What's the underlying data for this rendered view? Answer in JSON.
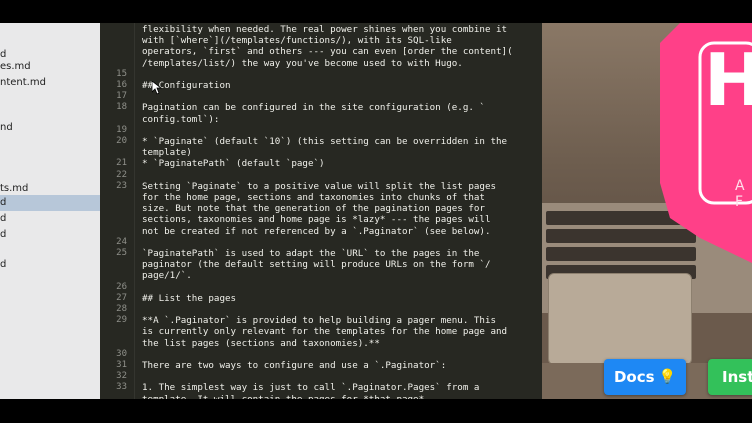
{
  "sidebar": {
    "items": [
      {
        "label": "d",
        "selected": false
      },
      {
        "label": "es.md",
        "selected": false
      },
      {
        "label": "ntent.md",
        "selected": false
      },
      {
        "label": "nd",
        "selected": false
      },
      {
        "label": "ts.md",
        "selected": false
      },
      {
        "label": "d",
        "selected": true
      },
      {
        "label": "d",
        "selected": false
      },
      {
        "label": "d",
        "selected": false
      },
      {
        "label": "d",
        "selected": false
      }
    ]
  },
  "editor": {
    "lines": [
      {
        "num": "",
        "text": "flexibility when needed. The real power shines when you combine it"
      },
      {
        "num": "",
        "text": "with [`where`](/templates/functions/), with its SQL-like"
      },
      {
        "num": "",
        "text": "operators, `first` and others --- you can even [order the content]("
      },
      {
        "num": "",
        "text": "/templates/list/) the way you've become used to with Hugo."
      },
      {
        "num": "15",
        "text": ""
      },
      {
        "num": "16",
        "text": "## Configuration"
      },
      {
        "num": "17",
        "text": ""
      },
      {
        "num": "18",
        "text": "Pagination can be configured in the site configuration (e.g. `"
      },
      {
        "num": "",
        "text": "config.toml`):"
      },
      {
        "num": "19",
        "text": ""
      },
      {
        "num": "20",
        "text": "* `Paginate` (default `10`) (this setting can be overridden in the"
      },
      {
        "num": "",
        "text": "template)"
      },
      {
        "num": "21",
        "text": "* `PaginatePath` (default `page`)"
      },
      {
        "num": "22",
        "text": ""
      },
      {
        "num": "23",
        "text": "Setting `Paginate` to a positive value will split the list pages"
      },
      {
        "num": "",
        "text": "for the home page, sections and taxonomies into chunks of that"
      },
      {
        "num": "",
        "text": "size. But note that the generation of the pagination pages for"
      },
      {
        "num": "",
        "text": "sections, taxonomies and home page is *lazy* --- the pages will"
      },
      {
        "num": "",
        "text": "not be created if not referenced by a `.Paginator` (see below)."
      },
      {
        "num": "24",
        "text": ""
      },
      {
        "num": "25",
        "text": "`PaginatePath` is used to adapt the `URL` to the pages in the"
      },
      {
        "num": "",
        "text": "paginator (the default setting will produce URLs on the form `/"
      },
      {
        "num": "",
        "text": "page/1/`."
      },
      {
        "num": "26",
        "text": ""
      },
      {
        "num": "27",
        "text": "## List the pages"
      },
      {
        "num": "28",
        "text": ""
      },
      {
        "num": "29",
        "text": "**A `.Paginator` is provided to help building a pager menu. This"
      },
      {
        "num": "",
        "text": "is currently only relevant for the templates for the home page and"
      },
      {
        "num": "",
        "text": "the list pages (sections and taxonomies).**"
      },
      {
        "num": "30",
        "text": ""
      },
      {
        "num": "31",
        "text": "There are two ways to configure and use a `.Paginator`:"
      },
      {
        "num": "32",
        "text": ""
      },
      {
        "num": "33",
        "text": "1. The simplest way is just to call `.Paginator.Pages` from a"
      },
      {
        "num": "",
        "text": "template. It will contain the pages for *that page*"
      }
    ]
  },
  "preview": {
    "logo_letter": "H",
    "tagline": "A F",
    "docs_label": "Docs",
    "docs_icon": "lightbulb-icon",
    "install_label": "Inst"
  },
  "colors": {
    "editor_bg": "#272822",
    "brand_pink": "#ff4088",
    "docs_blue": "#1e88f4",
    "install_green": "#33c15a"
  }
}
